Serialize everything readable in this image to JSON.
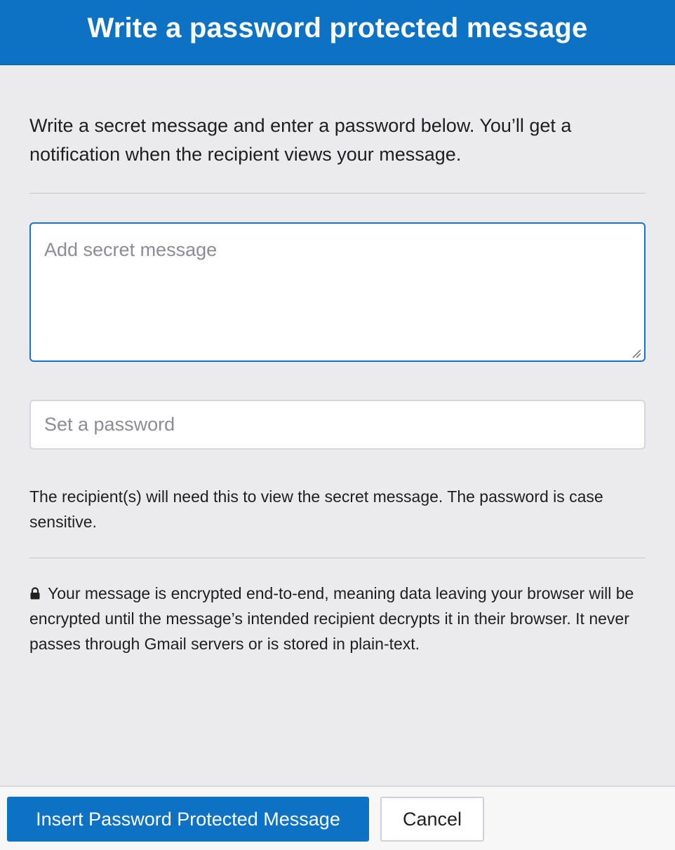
{
  "dialog": {
    "title": "Write a password protected message"
  },
  "intro": {
    "text": "Write a secret message and enter a password below. You’ll get a notification when the recipient views your message."
  },
  "message_field": {
    "placeholder": "Add secret message",
    "value": ""
  },
  "password_field": {
    "placeholder": "Set a password",
    "value": ""
  },
  "help": {
    "text": "The recipient(s) will need this to view the secret message. The password is case sensitive."
  },
  "security": {
    "icon": "lock-icon",
    "text": "Your message is encrypted end-to-end, meaning data leaving your browser will be encrypted until the message’s intended recipient decrypts it in their browser. It never passes through Gmail servers or is stored in plain-text."
  },
  "footer": {
    "insert_label": "Insert Password Protected Message",
    "cancel_label": "Cancel"
  },
  "colors": {
    "header_bg": "#0d72c4",
    "primary_button": "#0d72c4",
    "focus_border": "#1a73c9",
    "body_bg": "#ebebee"
  }
}
